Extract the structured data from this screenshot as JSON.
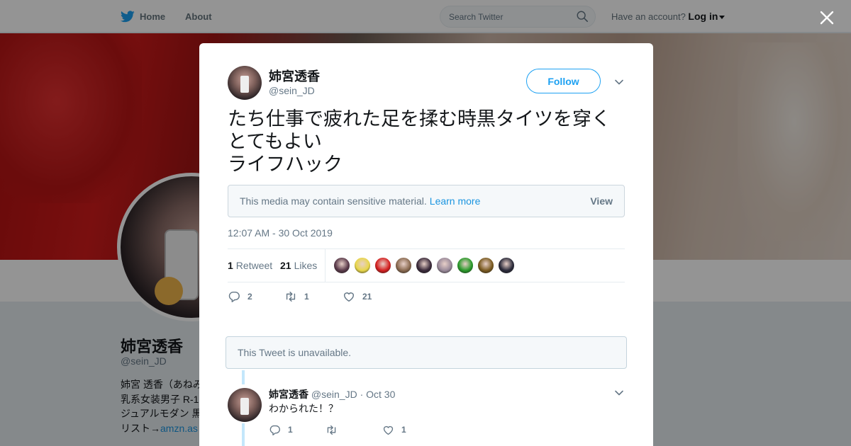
{
  "topbar": {
    "home_label": "Home",
    "about_label": "About",
    "search_placeholder": "Search Twitter",
    "account_prompt": "Have an account?",
    "login_label": "Log in"
  },
  "profile": {
    "name": "姉宮透香",
    "handle": "@sein_JD",
    "bio_lines": [
      "姉宮 透香（あねみ",
      "乳系女装男子 R-1",
      "ジュアルモダン 黒",
      "リスト→"
    ],
    "bio_link": "amzn.as"
  },
  "tweet": {
    "name": "姉宮透香",
    "handle": "@sein_JD",
    "follow_label": "Follow",
    "text": "たち仕事で疲れた足を揉む時黒タイツを穿く\nとてもよい\nライフハック",
    "sensitive_notice": "This media may contain sensitive material.",
    "learn_more": "Learn more",
    "view_label": "View",
    "timestamp": "12:07 AM - 30 Oct 2019",
    "retweets_count": "1",
    "retweets_label": "Retweet",
    "likes_count": "21",
    "likes_label": "Likes",
    "reply_count": "2",
    "retweet_action_count": "1",
    "like_action_count": "21"
  },
  "likers_colors": [
    "#5a3a4a",
    "#e8d64a",
    "#d42020",
    "#8a6a50",
    "#3a2a3a",
    "#9a8a9a",
    "#2a9a2a",
    "#7a5a20",
    "#2a2a3a"
  ],
  "unavailable_notice": "This Tweet is unavailable.",
  "reply": {
    "name": "姉宮透香",
    "handle": "@sein_JD",
    "dot": "·",
    "date": "Oct 30",
    "text": "わかられた！？",
    "reply_count": "1",
    "retweet_count": "",
    "like_count": "1"
  },
  "colors": {
    "twitter_blue": "#1da1f2",
    "link_blue": "#1b95e0",
    "muted": "#657786"
  }
}
